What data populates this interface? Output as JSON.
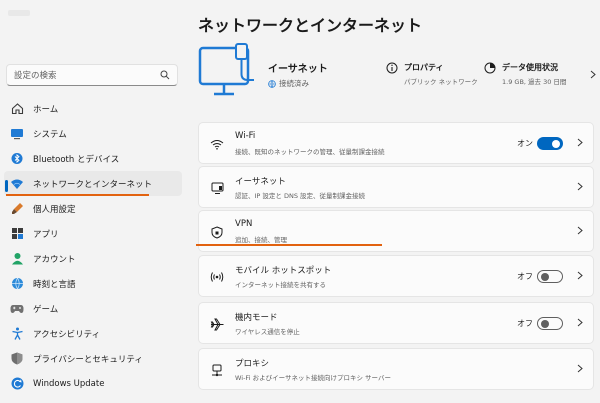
{
  "page_title": "ネットワークとインターネット",
  "search": {
    "placeholder": "設定の検索"
  },
  "sidebar": {
    "items": [
      {
        "label": "ホーム",
        "icon": "home-icon"
      },
      {
        "label": "システム",
        "icon": "system-icon"
      },
      {
        "label": "Bluetooth とデバイス",
        "icon": "bluetooth-icon"
      },
      {
        "label": "ネットワークとインターネット",
        "icon": "network-icon",
        "active": true
      },
      {
        "label": "個人用設定",
        "icon": "brush-icon"
      },
      {
        "label": "アプリ",
        "icon": "apps-icon"
      },
      {
        "label": "アカウント",
        "icon": "account-icon"
      },
      {
        "label": "時刻と言語",
        "icon": "globe-icon"
      },
      {
        "label": "ゲーム",
        "icon": "game-icon"
      },
      {
        "label": "アクセシビリティ",
        "icon": "accessibility-icon"
      },
      {
        "label": "プライバシーとセキュリティ",
        "icon": "shield-icon"
      },
      {
        "label": "Windows Update",
        "icon": "update-icon"
      }
    ]
  },
  "hero": {
    "title": "イーサネット",
    "status": "接続済み",
    "properties": {
      "title": "プロパティ",
      "sub": "パブリック ネットワーク"
    },
    "data_usage": {
      "title": "データ使用状況",
      "sub": "1.9 GB, 過去 30 日間"
    }
  },
  "cards": [
    {
      "title": "Wi-Fi",
      "sub": "接続、既知のネットワークの管理、従量制課金接続",
      "state": "オン",
      "toggle": "on",
      "icon": "wifi-icon"
    },
    {
      "title": "イーサネット",
      "sub": "認証、IP 設定と DNS 設定、従量制課金接続",
      "icon": "ethernet-icon"
    },
    {
      "title": "VPN",
      "sub": "追加、接続、管理",
      "icon": "vpn-shield-icon"
    },
    {
      "title": "モバイル ホットスポット",
      "sub": "インターネット接続を共有する",
      "state": "オフ",
      "toggle": "off",
      "icon": "hotspot-icon"
    },
    {
      "title": "機内モード",
      "sub": "ワイヤレス通信を停止",
      "state": "オフ",
      "toggle": "off",
      "icon": "airplane-icon"
    },
    {
      "title": "プロキシ",
      "sub": "Wi-Fi およびイーサネット接続向けプロキシ サーバー",
      "icon": "proxy-icon"
    }
  ],
  "colors": {
    "accent": "#0067c0",
    "annotation": "#e2620f"
  }
}
